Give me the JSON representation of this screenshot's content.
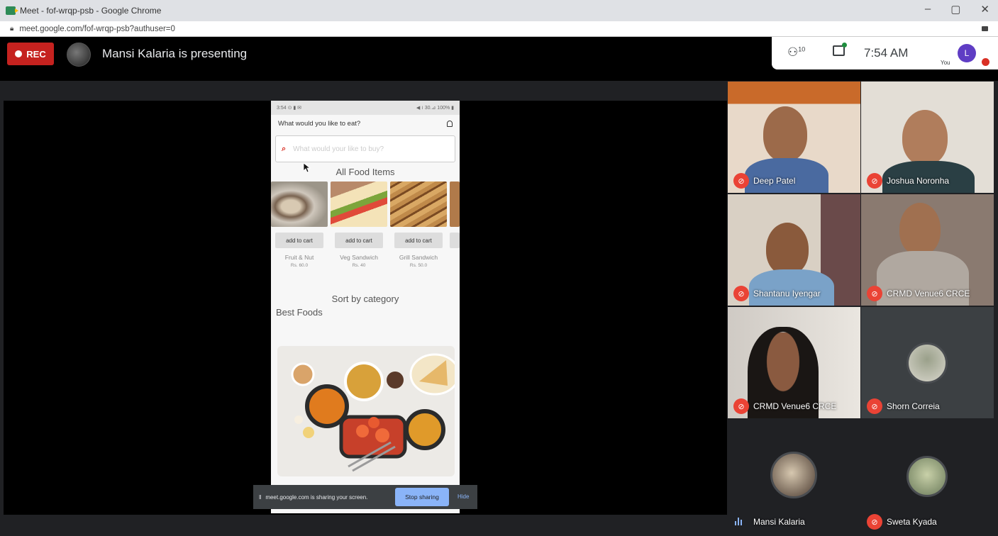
{
  "window": {
    "title": "Meet - fof-wrqp-psb - Google Chrome",
    "url": "meet.google.com/fof-wrqp-psb?authuser=0",
    "controls": [
      "–",
      "▢",
      "✕"
    ]
  },
  "meet": {
    "rec_label": "REC",
    "presenting_text": "Mansi Kalaria is presenting",
    "participants_count": "10",
    "time": "7:54 AM",
    "you_label": "You",
    "user_initial": "L"
  },
  "phone": {
    "status_left": "3:54 ⊙ ▮ ✉",
    "status_right": "◀ ≀ 30.⊿ 100% ▮",
    "header_title": "What would you like to eat?",
    "search_placeholder": "What would your like to buy?",
    "all_food_title": "All Food Items",
    "add_to_cart": "add to cart",
    "items": [
      {
        "name": "Fruit & Nut",
        "price": "Rs. 60.0"
      },
      {
        "name": "Veg Sandwich",
        "price": "Rs. 40"
      },
      {
        "name": "Grill Sandwich",
        "price": "Rs. 50.0"
      }
    ],
    "sort_title": "Sort by category",
    "best_title": "Best Foods"
  },
  "share_bar": {
    "text": "meet.google.com is sharing your screen.",
    "stop_label": "Stop sharing",
    "hide_label": "Hide"
  },
  "participants": [
    {
      "name": "Deep Patel",
      "muted": true
    },
    {
      "name": "Joshua Noronha",
      "muted": true
    },
    {
      "name": "Shantanu Iyengar",
      "muted": true
    },
    {
      "name": "CRMD Venue6 CRCE",
      "muted": true
    },
    {
      "name": "CRMD Venue6 CRCE",
      "muted": true
    },
    {
      "name": "Shorn Correia",
      "muted": true
    },
    {
      "name": "Mansi Kalaria",
      "muted": false
    },
    {
      "name": "Sweta Kyada",
      "muted": true
    }
  ],
  "colors": {
    "rec_red": "#c5221f",
    "meet_bg": "#202124",
    "mute_red": "#ea4335",
    "stop_blue": "#8ab4f8"
  }
}
